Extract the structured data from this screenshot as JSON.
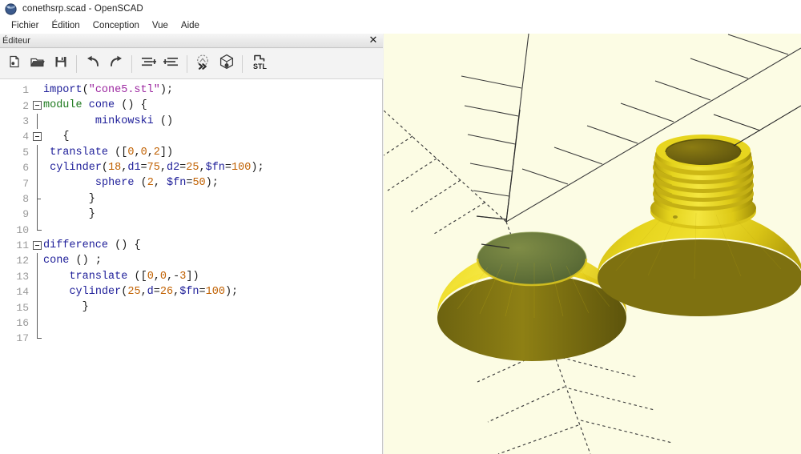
{
  "window": {
    "title": "conethsrp.scad - OpenSCAD",
    "icon": "openscad-logo-icon"
  },
  "menubar": {
    "items": [
      {
        "label": "Fichier",
        "name": "menu-fichier"
      },
      {
        "label": "Édition",
        "name": "menu-edition"
      },
      {
        "label": "Conception",
        "name": "menu-conception"
      },
      {
        "label": "Vue",
        "name": "menu-vue"
      },
      {
        "label": "Aide",
        "name": "menu-aide"
      }
    ]
  },
  "editor_dock": {
    "title": "Éditeur",
    "close_label": "✕"
  },
  "toolbar": {
    "buttons": [
      {
        "name": "new-file-icon",
        "title": "Nouveau"
      },
      {
        "name": "open-file-icon",
        "title": "Ouvrir"
      },
      {
        "name": "save-file-icon",
        "title": "Enregistrer"
      },
      {
        "name": "undo-icon",
        "title": "Annuler"
      },
      {
        "name": "redo-icon",
        "title": "Rétablir"
      },
      {
        "name": "unindent-icon",
        "title": "Désindenter"
      },
      {
        "name": "indent-icon",
        "title": "Indenter"
      },
      {
        "name": "preview-icon",
        "title": "Aperçu"
      },
      {
        "name": "render-icon",
        "title": "Rendu"
      },
      {
        "name": "export-stl-icon",
        "title": "Exporter STL",
        "label": "STL"
      }
    ]
  },
  "editor": {
    "line_count": 17,
    "lines": [
      {
        "n": "1",
        "fold": "none",
        "text": "import(\"cone5.stl\");"
      },
      {
        "n": "2",
        "fold": "start",
        "text": "module cone () {"
      },
      {
        "n": "3",
        "fold": "line",
        "text": "        minkowski ()"
      },
      {
        "n": "4",
        "fold": "start",
        "text": "   {"
      },
      {
        "n": "5",
        "fold": "line",
        "text": " translate ([0,0,2])"
      },
      {
        "n": "6",
        "fold": "line",
        "text": " cylinder(18,d1=75,d2=25,$fn=100);"
      },
      {
        "n": "7",
        "fold": "line",
        "text": "        sphere (2, $fn=50);"
      },
      {
        "n": "8",
        "fold": "tick",
        "text": "       }"
      },
      {
        "n": "9",
        "fold": "line",
        "text": "       }"
      },
      {
        "n": "10",
        "fold": "end",
        "text": ""
      },
      {
        "n": "11",
        "fold": "start",
        "text": "difference () {"
      },
      {
        "n": "12",
        "fold": "line",
        "text": "cone () ;"
      },
      {
        "n": "13",
        "fold": "line",
        "text": "    translate ([0,0,-3])"
      },
      {
        "n": "14",
        "fold": "line",
        "text": "    cylinder(25,d=26,$fn=100);"
      },
      {
        "n": "15",
        "fold": "line",
        "text": "      }"
      },
      {
        "n": "16",
        "fold": "line",
        "text": ""
      },
      {
        "n": "17",
        "fold": "end",
        "text": ""
      }
    ],
    "raw_source": "import(\"cone5.stl\");\nmodule cone () {\n        minkowski ()\n   {\n translate ([0,0,2])\n cylinder(18,d1=75,d2=25,$fn=100);\n        sphere (2, $fn=50);\n       }\n       }\n\ndifference () {\ncone () ;\n    translate ([0,0,-3])\n    cylinder(25,d=26,$fn=100);\n      }\n\n"
  },
  "viewport": {
    "name": "3d-preview-viewport",
    "background_color": "#fcfce4",
    "object_color": "#e8d21a",
    "object_highlight": "#f7e64a",
    "object_shadow": "#8a7d12",
    "cavity_color": "#6b7a3a",
    "axis_color": "#3a3a3a",
    "objects": [
      {
        "name": "cone-with-hole",
        "description": "Minkowski cone with central bore (difference)"
      },
      {
        "name": "imported-threaded-cone",
        "description": "Imported cone5.stl with threaded neck"
      }
    ],
    "axes": [
      {
        "name": "z-axis",
        "style": "solid",
        "ticks": 6
      },
      {
        "name": "y-axis",
        "style": "solid",
        "ticks": 7
      },
      {
        "name": "x-axis-front",
        "style": "dashed",
        "ticks": 7
      },
      {
        "name": "x-axis-left",
        "style": "dashed",
        "ticks": 6
      }
    ]
  }
}
